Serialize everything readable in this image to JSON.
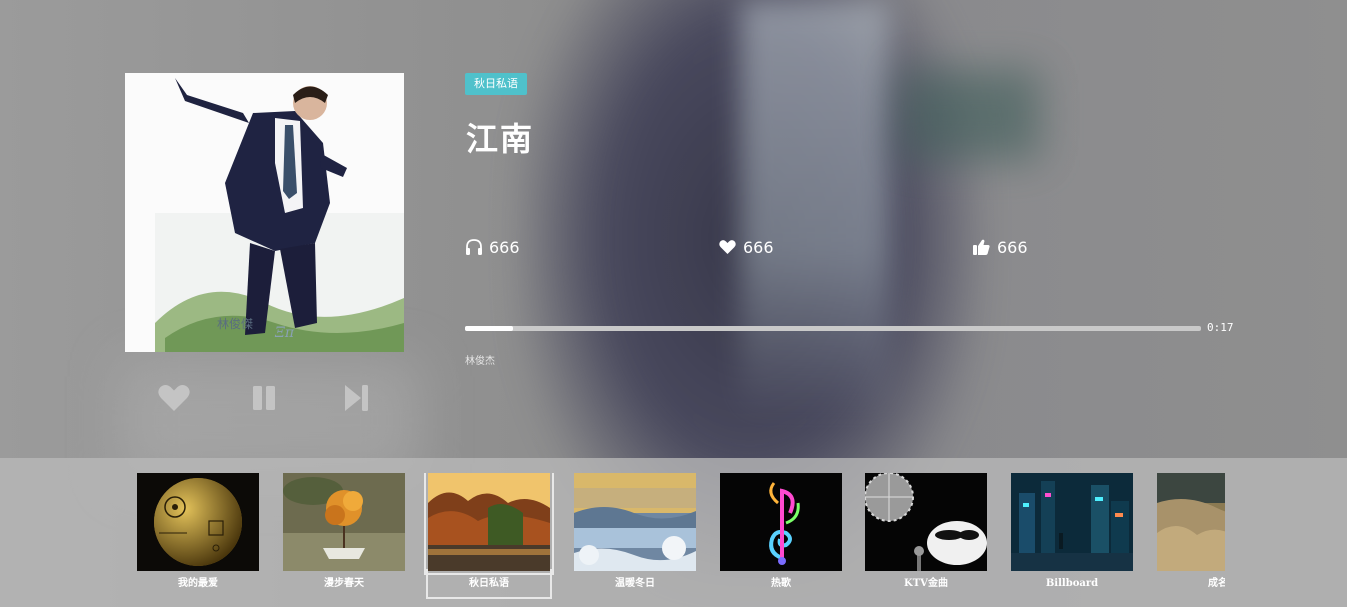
{
  "player": {
    "tag": "秋日私语",
    "title": "江南",
    "artist": "林俊杰",
    "time": "0:17",
    "progress": 0.065,
    "stats": {
      "listens": "666",
      "likes": "666",
      "thumbs": "666"
    },
    "controls": {
      "like": "heart-icon",
      "pause": "pause-icon",
      "next": "skip-next-icon"
    },
    "cover_text": "林俊傑"
  },
  "icons": {
    "listens": "headphones-icon",
    "likes": "heart-icon",
    "thumbs": "thumbs-up-icon"
  },
  "colors": {
    "tag": "#4fc1cb",
    "progress_track": "#c9c9c9",
    "progress_fill": "#ffffff"
  },
  "playlists": [
    {
      "label": "我的最爱",
      "active": false
    },
    {
      "label": "漫步春天",
      "active": false
    },
    {
      "label": "秋日私语",
      "active": true
    },
    {
      "label": "温暖冬日",
      "active": false
    },
    {
      "label": "热歌",
      "active": false
    },
    {
      "label": "KTV金曲",
      "active": false
    },
    {
      "label": "Billboard",
      "active": false
    },
    {
      "label": "成名",
      "active": false
    }
  ]
}
